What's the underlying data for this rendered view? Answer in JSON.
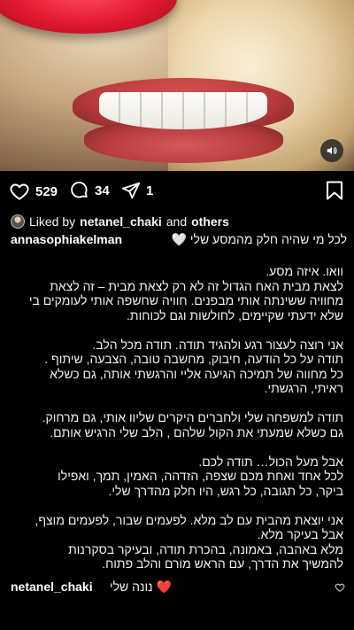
{
  "post": {
    "likes_count": "529",
    "comments_count": "34",
    "shares_count": "1",
    "icons": {
      "like": "heart-outline-icon",
      "comment": "speech-bubble-icon",
      "share": "paper-plane-icon",
      "save": "bookmark-icon",
      "audio": "speaker-icon"
    }
  },
  "liked_by": {
    "prefix": "Liked by",
    "user": "netanel_chaki",
    "connector": "and",
    "others": "others"
  },
  "caption": {
    "username": "annasophiakelman",
    "first_line": "לכל מי שהיה חלק מהמסע שלי 🤍",
    "lines": [
      "וואו. איזה מסע.",
      "לצאת מבית האח הגדול זה לא רק לצאת מבית – זה לצאת",
      "מחוויה ששינתה אותי מבפנים. חוויה שחשפה אותי לעומקים בי",
      "שלא ידעתי שקיימים, לחולשות וגם לכוחות.",
      "אני רוצה לעצור רגע ולהגיד תודה. תודה מכל הלב.",
      "תודה על כל הודעה, חיבוק, מחשבה טובה, הצבעה, שיתוף .",
      "כל מחווה של תמיכה הגיעה אליי והרגשתי אותה, גם כשלא",
      "ראיתי, הרגשתי.",
      "תודה למשפחה שלי ולחברים היקרים שליוו אותי, גם מרחוק.",
      "גם כשלא שמעתי את הקול שלהם , הלב שלי הרגיש אותם.",
      "אבל מעל הכול… תודה לכם.",
      "לכל אחד ואחת מכם שצפה, הזדהה, האמין, תמך, ואפילו",
      "ביקר, כל תגובה, כל רגש, היו חלק מהדרך שלי.",
      "אני יוצאת מהבית עם לב מלא. לפעמים שבור, לפעמים מוצף,",
      "אבל בעיקר מלא.",
      "מלא באהבה, באמונה, בהכרת תודה, ובעיקר בסקרנות",
      "להמשיך את הדרך, עם הראש מורם והלב פתוח."
    ]
  },
  "comment": {
    "username": "netanel_chaki",
    "text": "❤️ נונה שלי"
  },
  "colors": {
    "background": "#000000",
    "text": "#f5f5f5",
    "heart_red": "#e3192f"
  }
}
